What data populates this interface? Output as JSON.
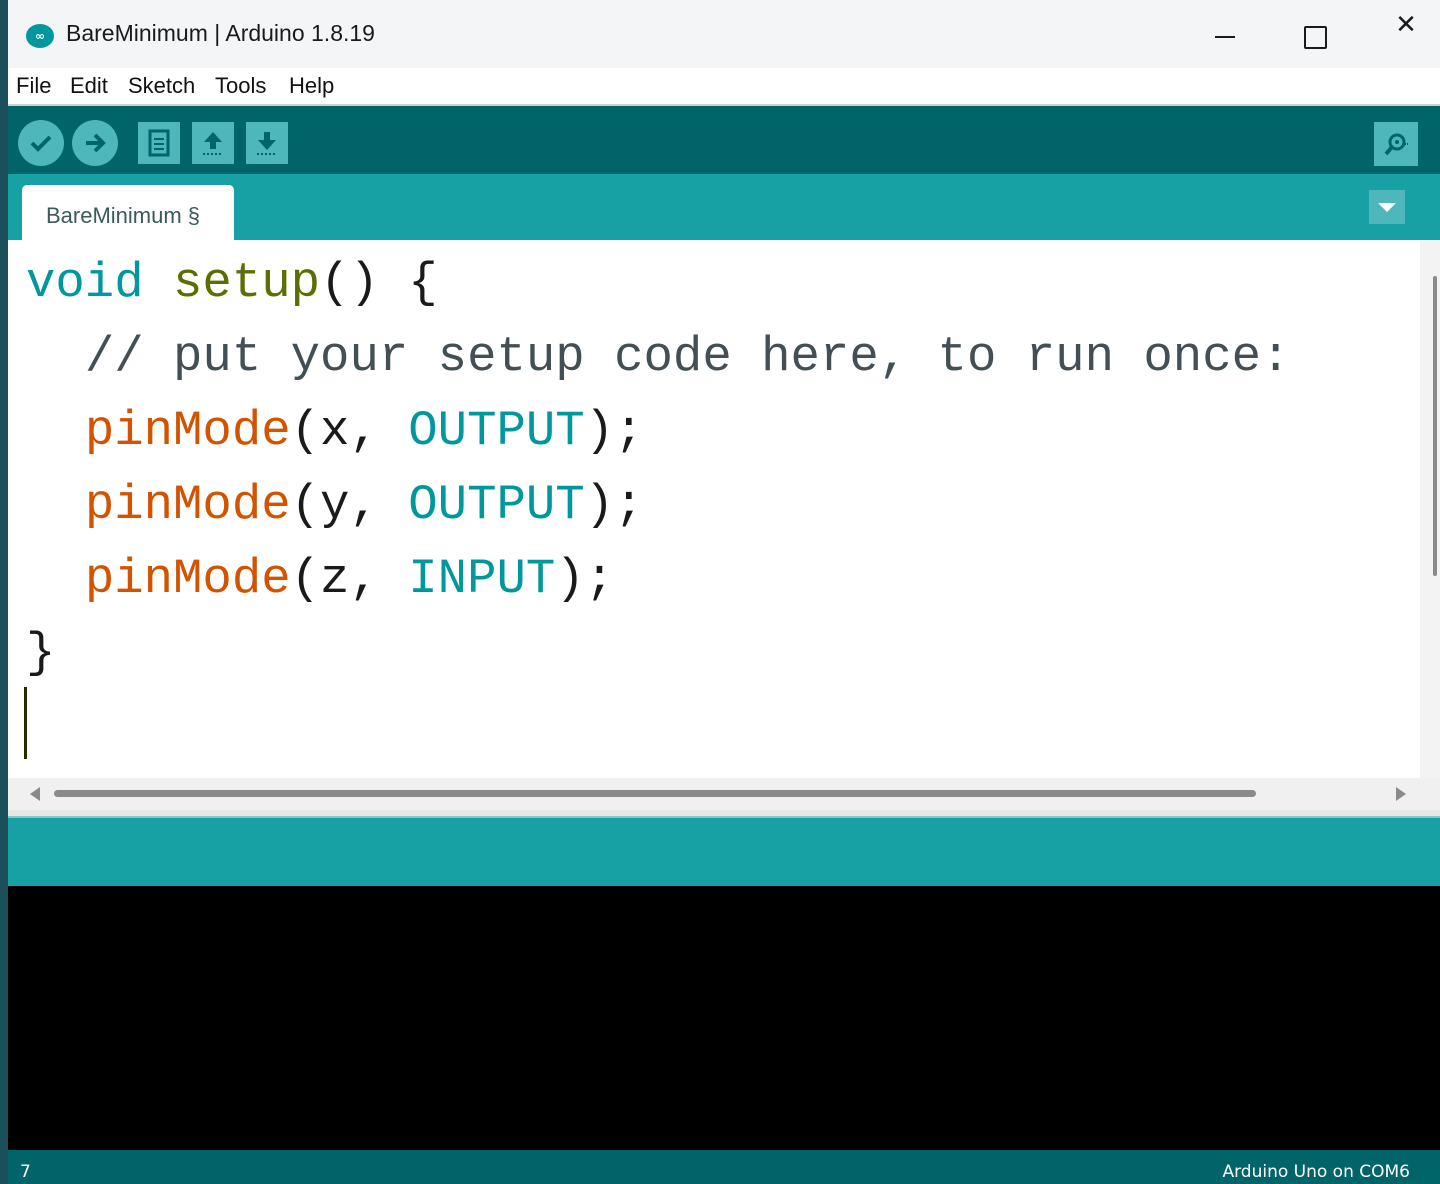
{
  "window": {
    "title": "BareMinimum | Arduino 1.8.19",
    "logo_text": "∞",
    "close_glyph": "✕"
  },
  "menu": [
    "File",
    "Edit",
    "Sketch",
    "Tools",
    "Help"
  ],
  "toolbar": {
    "buttons": [
      "verify-icon",
      "upload-icon",
      "new-icon",
      "open-icon",
      "save-icon"
    ],
    "right": "serial-monitor-icon"
  },
  "tabs": [
    {
      "label": "BareMinimum §"
    }
  ],
  "editor": {
    "line1": {
      "type": "void",
      "func": "setup",
      "rest": "() {"
    },
    "line2": {
      "indent": "  ",
      "comment": "// put your setup code here, to run once:"
    },
    "line3": {
      "indent": "  ",
      "func": "pinMode",
      "arg": "(x, ",
      "const": "OUTPUT",
      "end": ");"
    },
    "line4": {
      "indent": "  ",
      "func": "pinMode",
      "arg": "(y, ",
      "const": "OUTPUT",
      "end": ");"
    },
    "line5": {
      "indent": "  ",
      "func": "pinMode",
      "arg": "(z, ",
      "const": "INPUT",
      "end": ");"
    },
    "line6": {
      "text": "}"
    }
  },
  "footer": {
    "line_number": "7",
    "board": "Arduino Uno on COM6"
  },
  "colors": {
    "toolbar": "#006468",
    "tabstrip": "#17a1a5",
    "keyword": "#00979d",
    "function": "#d35400",
    "setup_function": "#5e6d03"
  }
}
